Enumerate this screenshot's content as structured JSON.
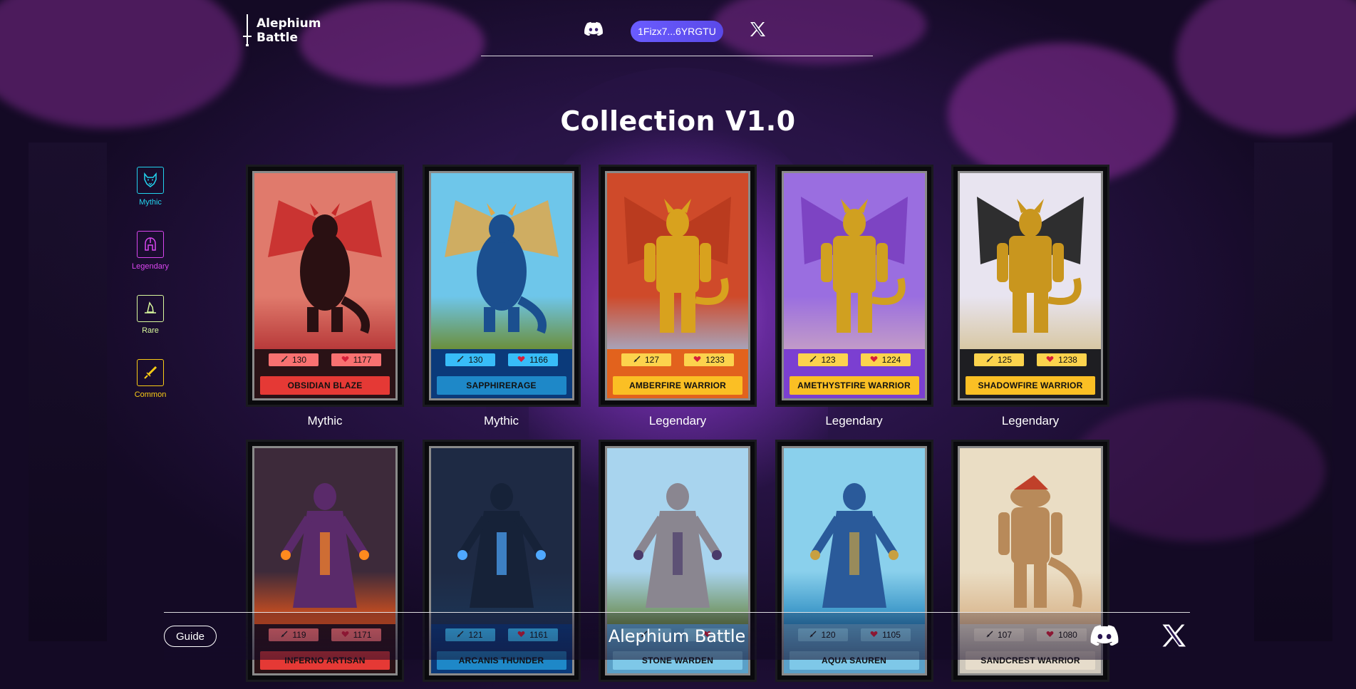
{
  "header": {
    "logo_line1": "Alephium",
    "logo_line2": "Battle",
    "wallet_address": "1Fizx7...6YRGTU",
    "discord_icon": "discord-icon",
    "x_icon": "x-icon"
  },
  "page": {
    "title": "Collection V1.0"
  },
  "filters": [
    {
      "label": "Mythic",
      "icon": "wolf-icon",
      "color": "#22d3ee"
    },
    {
      "label": "Legendary",
      "icon": "helmet-icon",
      "color": "#d946ef"
    },
    {
      "label": "Rare",
      "icon": "wizard-hat-icon",
      "color": "#d9f99d"
    },
    {
      "label": "Common",
      "icon": "sword-icon",
      "color": "#facc15"
    }
  ],
  "cards": [
    {
      "name": "OBSIDIAN BLAZE",
      "rarity": "Mythic",
      "attack": "130",
      "health": "1177",
      "figure": "dragon",
      "sky": "#e07a6c",
      "ground": "#b83a3a",
      "figcolor": "#2a1012",
      "accent": "#c62828",
      "statbg": "#2a1216",
      "barcolor": "#e53935",
      "statcolor": "#f87171"
    },
    {
      "name": "SAPPHIRERAGE",
      "rarity": "Mythic",
      "attack": "130",
      "health": "1166",
      "figure": "dragon",
      "sky": "#6ec6ea",
      "ground": "#6b8f3c",
      "figcolor": "#1b4f8f",
      "accent": "#e0a84a",
      "statbg": "#0b3a7a",
      "barcolor": "#1e88c8",
      "statcolor": "#38bdf8"
    },
    {
      "name": "AMBERFIRE WARRIOR",
      "rarity": "Legendary",
      "attack": "127",
      "health": "1233",
      "figure": "warrior",
      "sky": "#cf4a2a",
      "ground": "#a8a2b8",
      "figcolor": "#d8a21e",
      "accent": "#b73a1e",
      "statbg": "#e2621d",
      "barcolor": "#fbbf24",
      "statcolor": "#fcd34d"
    },
    {
      "name": "AMETHYSTFIRE WARRIOR",
      "rarity": "Legendary",
      "attack": "123",
      "health": "1224",
      "figure": "warrior",
      "sky": "#9a6ee0",
      "ground": "#c29bc8",
      "figcolor": "#d0a020",
      "accent": "#7a3fc0",
      "statbg": "#7b3fd1",
      "barcolor": "#fbbf24",
      "statcolor": "#fcd34d"
    },
    {
      "name": "SHADOWFIRE WARRIOR",
      "rarity": "Legendary",
      "attack": "125",
      "health": "1238",
      "figure": "warrior",
      "sky": "#e8e4f0",
      "ground": "#d8c8a4",
      "figcolor": "#c9961e",
      "accent": "#1a1a1a",
      "statbg": "#1e1e22",
      "barcolor": "#fbbf24",
      "statcolor": "#fcd34d"
    },
    {
      "name": "INFERNO ARTISAN",
      "rarity": "",
      "attack": "119",
      "health": "1171",
      "figure": "mage",
      "sky": "#3d2a3a",
      "ground": "#e0541c",
      "figcolor": "#5a2a6a",
      "accent": "#ff8a1e",
      "statbg": "#2a1216",
      "barcolor": "#e53935",
      "statcolor": "#f87171"
    },
    {
      "name": "ARCANIS THUNDER",
      "rarity": "",
      "attack": "121",
      "health": "1161",
      "figure": "mage",
      "sky": "#1e2a44",
      "ground": "#1c3454",
      "figcolor": "#162238",
      "accent": "#4fa8ff",
      "statbg": "#0b3a7a",
      "barcolor": "#1e88c8",
      "statcolor": "#38bdf8"
    },
    {
      "name": "STONE WARDEN",
      "rarity": "",
      "attack": "",
      "health": "",
      "figure": "mage",
      "sky": "#a8d4ee",
      "ground": "#6a8a4a",
      "figcolor": "#8a8690",
      "accent": "#4a3a6a",
      "statbg": "#5aa0c8",
      "barcolor": "#7ec8e8",
      "statcolor": "#7ec8e8"
    },
    {
      "name": "AQUA SAUREN",
      "rarity": "",
      "attack": "120",
      "health": "1105",
      "figure": "mage",
      "sky": "#8ad0ec",
      "ground": "#2a8ac0",
      "figcolor": "#2a5a9a",
      "accent": "#c8a040",
      "statbg": "#5aa0c8",
      "barcolor": "#7ec8e8",
      "statcolor": "#7ec8e8"
    },
    {
      "name": "SANDCREST WARRIOR",
      "rarity": "",
      "attack": "107",
      "health": "1080",
      "figure": "lizard",
      "sky": "#eaddc4",
      "ground": "#d8b48a",
      "figcolor": "#b88a5a",
      "accent": "#c0402a",
      "statbg": "#cfc8bc",
      "barcolor": "#e6dccb",
      "statcolor": "#e8e0d0"
    }
  ],
  "footer": {
    "guide_label": "Guide",
    "brand": "Alephium Battle",
    "discord_icon": "discord-icon",
    "x_icon": "x-icon"
  }
}
